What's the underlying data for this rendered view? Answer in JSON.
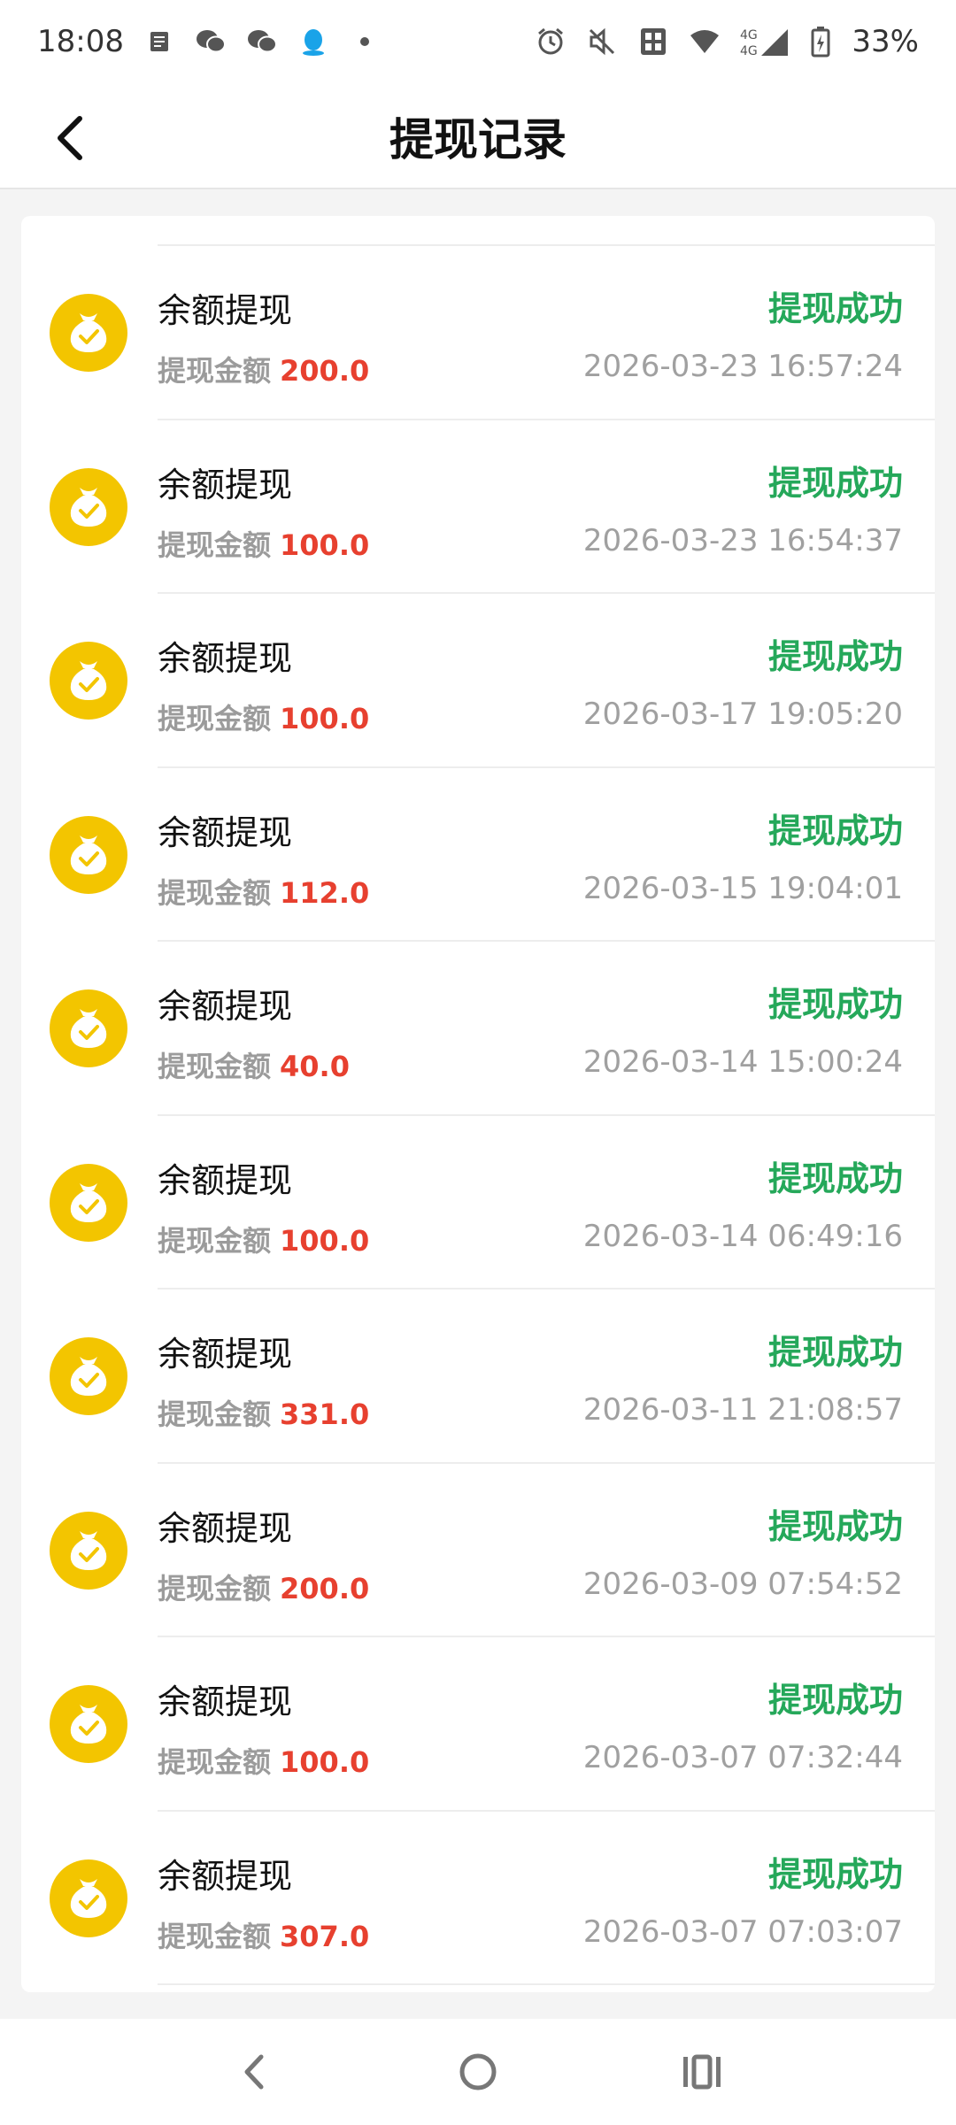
{
  "status_bar": {
    "time": "18:08",
    "battery": "33%",
    "left_icons": [
      "notes-icon",
      "wechat-icon",
      "wechat-icon",
      "qq-icon",
      "dot-icon"
    ],
    "right_icons": [
      "alarm-icon",
      "mute-icon",
      "nfc-icon",
      "wifi-icon",
      "signal-4g-icon",
      "battery-icon"
    ]
  },
  "header": {
    "title": "提现记录",
    "back_icon": "chevron-left-icon"
  },
  "records": [
    {
      "title": "余额提现",
      "amount_label": "提现金额",
      "amount": "200.0",
      "status": "提现成功",
      "time": "2026-03-23 16:57:24"
    },
    {
      "title": "余额提现",
      "amount_label": "提现金额",
      "amount": "100.0",
      "status": "提现成功",
      "time": "2026-03-23 16:54:37"
    },
    {
      "title": "余额提现",
      "amount_label": "提现金额",
      "amount": "100.0",
      "status": "提现成功",
      "time": "2026-03-17 19:05:20"
    },
    {
      "title": "余额提现",
      "amount_label": "提现金额",
      "amount": "112.0",
      "status": "提现成功",
      "time": "2026-03-15 19:04:01"
    },
    {
      "title": "余额提现",
      "amount_label": "提现金额",
      "amount": "40.0",
      "status": "提现成功",
      "time": "2026-03-14 15:00:24"
    },
    {
      "title": "余额提现",
      "amount_label": "提现金额",
      "amount": "100.0",
      "status": "提现成功",
      "time": "2026-03-14 06:49:16"
    },
    {
      "title": "余额提现",
      "amount_label": "提现金额",
      "amount": "331.0",
      "status": "提现成功",
      "time": "2026-03-11 21:08:57"
    },
    {
      "title": "余额提现",
      "amount_label": "提现金额",
      "amount": "200.0",
      "status": "提现成功",
      "time": "2026-03-09 07:54:52"
    },
    {
      "title": "余额提现",
      "amount_label": "提现金额",
      "amount": "100.0",
      "status": "提现成功",
      "time": "2026-03-07 07:32:44"
    },
    {
      "title": "余额提现",
      "amount_label": "提现金额",
      "amount": "307.0",
      "status": "提现成功",
      "time": "2026-03-07 07:03:07"
    }
  ],
  "nav_bar": {
    "icons": [
      "nav-back-icon",
      "nav-home-icon",
      "nav-recents-icon"
    ]
  },
  "colors": {
    "status_success": "#25a85a",
    "amount": "#e7402f",
    "icon_yellow": "#f3c500",
    "secondary_text": "#a0a0a0"
  }
}
